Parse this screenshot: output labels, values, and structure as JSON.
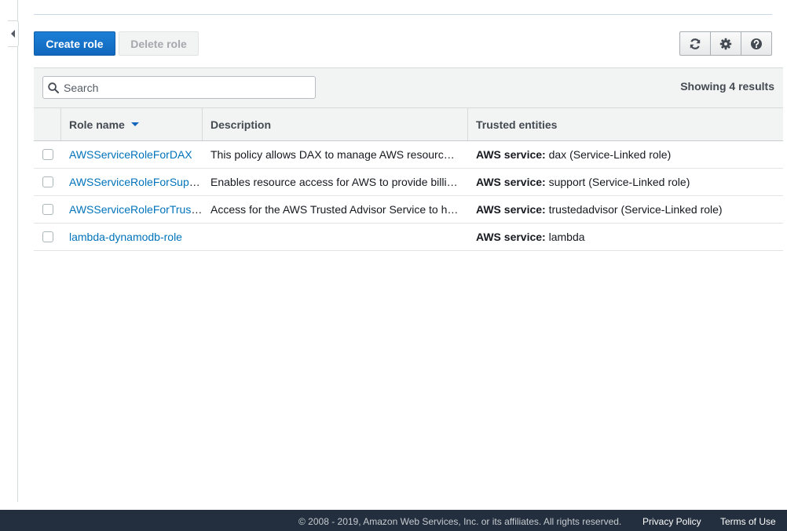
{
  "toolbar": {
    "create_label": "Create role",
    "delete_label": "Delete role",
    "icons": [
      "refresh-icon",
      "gear-icon",
      "help-icon"
    ]
  },
  "search": {
    "placeholder": "Search",
    "value": ""
  },
  "results_text": "Showing 4 results",
  "table": {
    "columns": [
      "Role name",
      "Description",
      "Trusted entities"
    ],
    "sort_column": "Role name",
    "sort_direction": "descending",
    "rows": [
      {
        "name": "AWSServiceRoleForDAX",
        "description": "This policy allows DAX to manage AWS resources on your behalf as necessary for managing your cache.",
        "trust_label": "AWS service:",
        "trust_service": "dax",
        "trust_suffix": "(Service-Linked role)"
      },
      {
        "name": "AWSServiceRoleForSupport",
        "description": "Enables resource access for AWS to provide billing, administrative and support services",
        "trust_label": "AWS service:",
        "trust_service": "support",
        "trust_suffix": "(Service-Linked role)"
      },
      {
        "name": "AWSServiceRoleForTrustedAdvisor",
        "description": "Access for the AWS Trusted Advisor Service to help reduce cost, increase performance, and improve security of your AWS environment.",
        "trust_label": "AWS service:",
        "trust_service": "trustedadvisor",
        "trust_suffix": "(Service-Linked role)"
      },
      {
        "name": "lambda-dynamodb-role",
        "description": "",
        "trust_label": "AWS service:",
        "trust_service": "lambda",
        "trust_suffix": ""
      }
    ]
  },
  "footer": {
    "copyright": "© 2008 - 2019, Amazon Web Services, Inc. or its affiliates. All rights reserved.",
    "privacy": "Privacy Policy",
    "terms": "Terms of Use"
  },
  "colors": {
    "primary": "#1168bd",
    "link": "#0073bb",
    "footer_bg": "#232f3e"
  }
}
